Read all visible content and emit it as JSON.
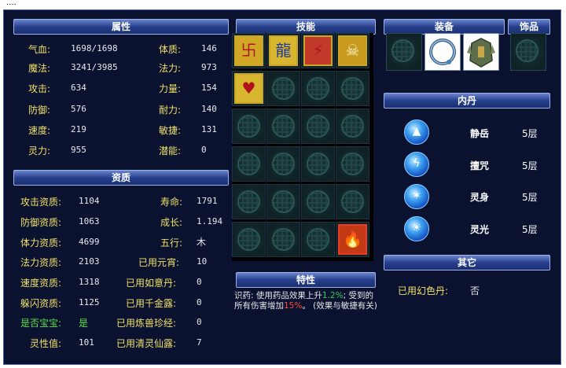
{
  "window": {
    "title": "...."
  },
  "headers": {
    "attributes": "属性",
    "skills": "技能",
    "equipment": "装备",
    "accessory": "饰品",
    "qualities": "资质",
    "inner_dan": "内丹",
    "traits": "特性",
    "other": "其它"
  },
  "attributes": [
    {
      "label": "气血:",
      "value": "1698/1698"
    },
    {
      "label": "魔法:",
      "value": "3241/3985"
    },
    {
      "label": "攻击:",
      "value": "634"
    },
    {
      "label": "防御:",
      "value": "576"
    },
    {
      "label": "速度:",
      "value": "219"
    },
    {
      "label": "灵力:",
      "value": "955"
    }
  ],
  "attributes_right": [
    {
      "label": "体质:",
      "value": "146"
    },
    {
      "label": "法力:",
      "value": "973"
    },
    {
      "label": "力量:",
      "value": "154"
    },
    {
      "label": "耐力:",
      "value": "140"
    },
    {
      "label": "敏捷:",
      "value": "131"
    },
    {
      "label": "潜能:",
      "value": "0"
    }
  ],
  "qualities_left": [
    {
      "label": "攻击资质:",
      "value": "1104"
    },
    {
      "label": "防御资质:",
      "value": "1063"
    },
    {
      "label": "体力资质:",
      "value": "4699"
    },
    {
      "label": "法力资质:",
      "value": "2103"
    },
    {
      "label": "速度资质:",
      "value": "1318"
    },
    {
      "label": "躲闪资质:",
      "value": "1125"
    },
    {
      "label": "是否宝宝:",
      "value": "是"
    },
    {
      "label": "灵性值:",
      "value": "101"
    }
  ],
  "qualities_right": [
    {
      "label": "寿命:",
      "value": "1791"
    },
    {
      "label": "成长:",
      "value": "1.194"
    },
    {
      "label": "五行:",
      "value": "木"
    },
    {
      "label": "已用元宵:",
      "value": "10"
    },
    {
      "label": "已用如意丹:",
      "value": "0"
    },
    {
      "label": "已用千金露:",
      "value": "0"
    },
    {
      "label": "已用炼兽珍经:",
      "value": "0"
    },
    {
      "label": "已用清灵仙露:",
      "value": "7"
    }
  ],
  "skills": {
    "filled": [
      {
        "row": 0,
        "col": 0,
        "icon": "red-rune-icon",
        "color": "#d0a826"
      },
      {
        "row": 0,
        "col": 1,
        "icon": "blue-dragon-icon",
        "color": "#d8b630"
      },
      {
        "row": 0,
        "col": 2,
        "icon": "red-slash-icon",
        "color": "#c13a2a"
      },
      {
        "row": 0,
        "col": 3,
        "icon": "skeleton-icon",
        "color": "#c79a1e"
      },
      {
        "row": 1,
        "col": 0,
        "icon": "red-heart-icon",
        "color": "#d7b52e"
      },
      {
        "row": 5,
        "col": 3,
        "icon": "fire-icon",
        "color": "#c23a14"
      }
    ]
  },
  "inner_dan": [
    {
      "name": "静岳",
      "level": "5层",
      "icon": "mountain-orb-icon"
    },
    {
      "name": "擅咒",
      "level": "5层",
      "icon": "lightning-orb-icon"
    },
    {
      "name": "灵身",
      "level": "5层",
      "icon": "claw-orb-icon"
    },
    {
      "name": "灵光",
      "level": "5层",
      "icon": "aura-orb-icon"
    }
  ],
  "trait": {
    "p1": "识药: 使用药品效果上升",
    "v1": "1.2%",
    "p2": "; 受到的所有伤害增加",
    "v2": "15%",
    "p3": "。 (效果与敏捷有关)"
  },
  "other": {
    "label": "已用幻色丹:",
    "value": "否"
  },
  "colors": {
    "panel_bg": "#0a1230",
    "label_yellow": "#f0e068",
    "header_blue": "#27408c"
  }
}
